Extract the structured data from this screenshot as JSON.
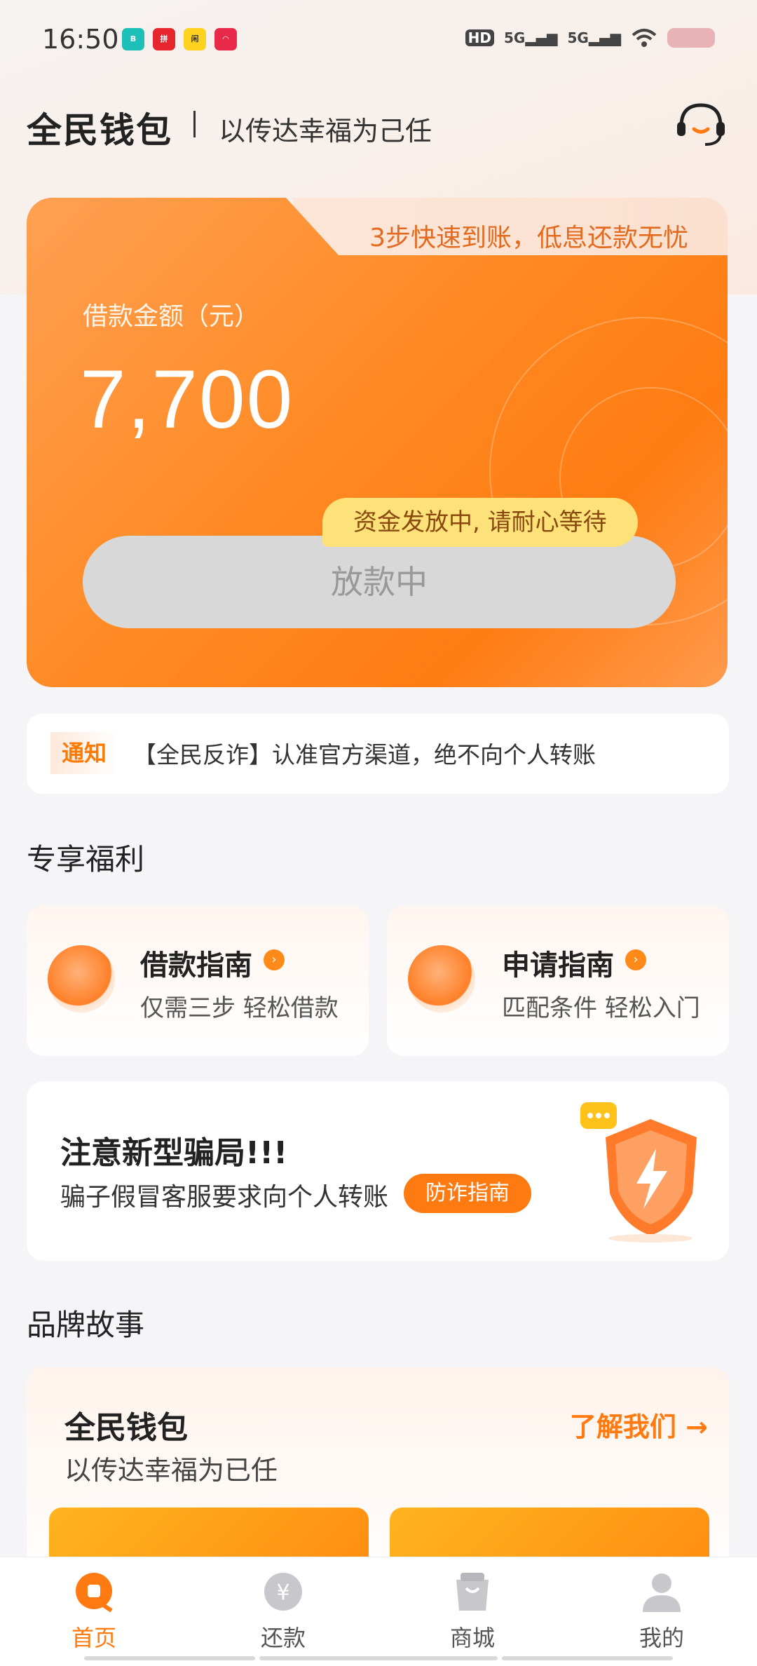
{
  "status_bar": {
    "time": "16:50",
    "hd_label": "HD",
    "signal1": "5G",
    "signal2": "5G",
    "app_icons": [
      "BOSS直聘",
      "拼多多",
      "闲鱼",
      "红色应用"
    ]
  },
  "header": {
    "brand": "全民钱包",
    "slogan": "以传达幸福为己任",
    "service_icon": "customer-service-icon"
  },
  "loan_card": {
    "tab_text": "3步快速到账，低息还款无忧",
    "amount_label": "借款金额（元）",
    "amount": "7,700",
    "status_button": "放款中",
    "tip": "资金发放中, 请耐心等待"
  },
  "notice": {
    "tag": "通知",
    "text": "【全民反诈】认准官方渠道，绝不向个人转账"
  },
  "welfare": {
    "title": "专享福利",
    "cards": [
      {
        "title": "借款指南",
        "subtitle": "仅需三步  轻松借款",
        "icon": "loan-guide-icon"
      },
      {
        "title": "申请指南",
        "subtitle": "匹配条件  轻松入门",
        "icon": "apply-guide-icon"
      }
    ]
  },
  "fraud": {
    "title": "注意新型骗局!!!",
    "subtitle": "骗子假冒客服要求向个人转账",
    "button": "防诈指南",
    "icon": "shield-lightning-icon"
  },
  "brand_story": {
    "section_title": "品牌故事",
    "title": "全民钱包",
    "subtitle": "以传达幸福为已任",
    "link": "了解我们 →"
  },
  "bottom_nav": {
    "items": [
      {
        "label": "首页",
        "icon": "home-icon",
        "active": true
      },
      {
        "label": "还款",
        "icon": "repay-icon",
        "active": false
      },
      {
        "label": "商城",
        "icon": "shop-bag-icon",
        "active": false
      },
      {
        "label": "我的",
        "icon": "profile-icon",
        "active": false
      }
    ]
  },
  "colors": {
    "accent": "#ff7a10",
    "card_orange": "#ff8a24",
    "tip_yellow": "#fde27a",
    "disabled_button": "#d8d8d8"
  }
}
